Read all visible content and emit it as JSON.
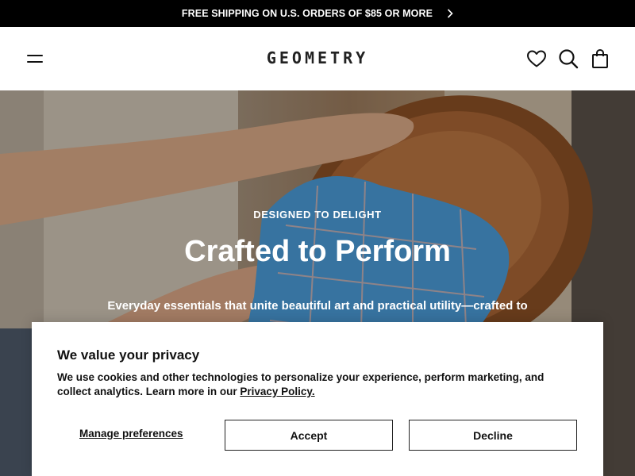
{
  "announcement": {
    "text": "FREE SHIPPING ON U.S. ORDERS OF $85 OR MORE",
    "arrow_icon": "chevron-right-icon"
  },
  "header": {
    "logo": "GEOMETRY",
    "icons": [
      "menu-icon",
      "heart-icon",
      "search-icon",
      "bag-icon"
    ]
  },
  "hero": {
    "eyebrow": "DESIGNED TO DELIGHT",
    "title": "Crafted to Perform",
    "subtitle": "Everyday essentials that unite beautiful art and practical utility—crafted to elevate daily life"
  },
  "cookie_banner": {
    "title": "We value your privacy",
    "text_before_link": "We use cookies and other technologies to personalize your experience, perform marketing, and collect analytics. Learn more in our ",
    "link_text": "Privacy Policy.",
    "manage_label": "Manage preferences",
    "accept_label": "Accept",
    "decline_label": "Decline"
  },
  "colors": {
    "announcement_bg": "#000000",
    "text": "#111111",
    "banner_bg": "#ffffff"
  }
}
